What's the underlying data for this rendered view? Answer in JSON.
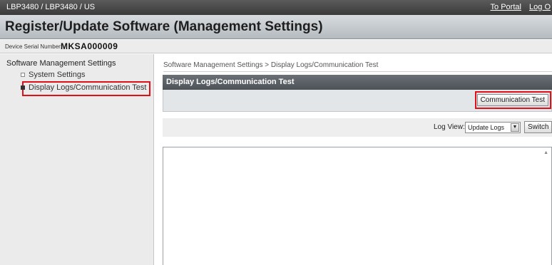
{
  "topbar": {
    "model": "LBP3480 / LBP3480 / US",
    "to_portal": "To Portal",
    "log_out": "Log O"
  },
  "title": "Register/Update Software (Management Settings)",
  "serial": {
    "label": "Device Serial Number:",
    "value": "MKSA000009"
  },
  "sidebar": {
    "heading": "Software Management Settings",
    "items": [
      {
        "label": "System Settings",
        "selected": false
      },
      {
        "label": "Display Logs/Communication Test",
        "selected": true
      }
    ]
  },
  "main": {
    "breadcrumb": "Software Management Settings > Display Logs/Communication Test",
    "panel_title": "Display Logs/Communication Test",
    "comm_test_label": "Communication Test",
    "log_view_label": "Log View:",
    "log_view_selected": "Update Logs",
    "switch_label": "Switch"
  },
  "colors": {
    "highlight": "#e0101a",
    "topbar": "#3a3a3a",
    "panel_header": "#4c5257"
  },
  "icons": {
    "dropdown": "chevron-down-icon",
    "scroll": "scroll-up-icon",
    "bullet": "square-bullet-icon"
  }
}
